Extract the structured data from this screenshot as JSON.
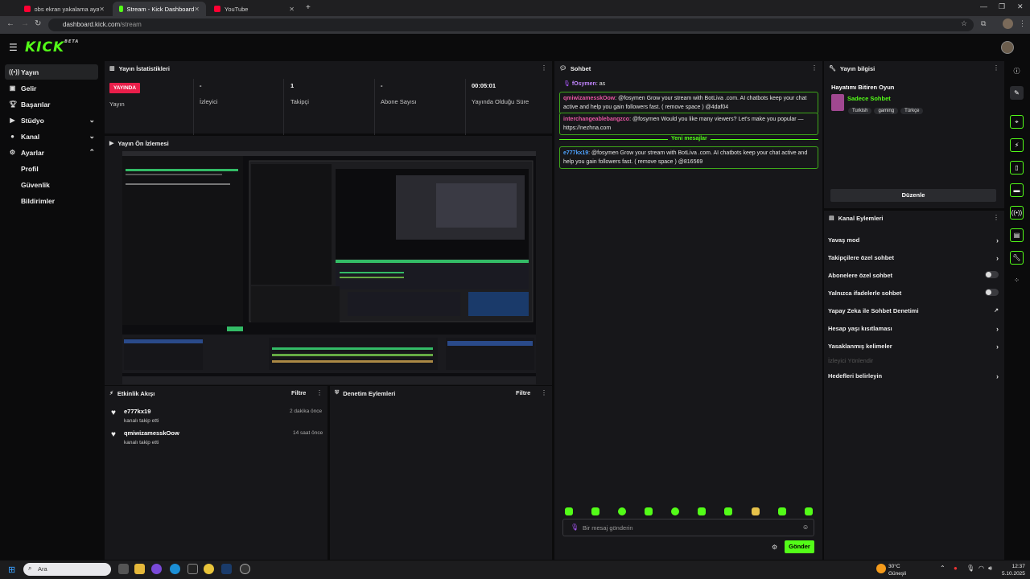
{
  "browser": {
    "tabs": [
      {
        "label": "obs ekran yakalama ayarları - Yo",
        "color": "#ff0033"
      },
      {
        "label": "Stream - Kick Dashboard",
        "color": "#53fc18"
      },
      {
        "label": "YouTube",
        "color": "#ff0033"
      }
    ],
    "url_host": "dashboard.kick.com",
    "url_path": "/stream"
  },
  "logo": "KICK",
  "sidebar": {
    "items": [
      {
        "label": "Yayın",
        "icon": "broadcast-icon"
      },
      {
        "label": "Gelir",
        "icon": "wallet-icon"
      },
      {
        "label": "Başarılar",
        "icon": "trophy-icon"
      },
      {
        "label": "Stüdyo",
        "icon": "video-icon"
      },
      {
        "label": "Kanal",
        "icon": "user-icon"
      },
      {
        "label": "Ayarlar",
        "icon": "gear-icon"
      }
    ],
    "sub_items": [
      "Profil",
      "Güvenlik",
      "Bildirimler"
    ]
  },
  "stats": {
    "title": "Yayın İstatistikleri",
    "live_badge": "YAYINDA",
    "items": [
      {
        "value": "",
        "label": "Yayın"
      },
      {
        "value": "-",
        "label": "İzleyici"
      },
      {
        "value": "1",
        "label": "Takipçi"
      },
      {
        "value": "-",
        "label": "Abone Sayısı"
      },
      {
        "value": "00:05:01",
        "label": "Yayında Olduğu Süre"
      }
    ]
  },
  "preview": {
    "title": "Yayın Ön İzlemesi"
  },
  "activity": {
    "title": "Etkinlik Akışı",
    "filter": "Filtre",
    "items": [
      {
        "user": "e777kx19",
        "action": "kanalı takip etti",
        "time": "2 dakika önce"
      },
      {
        "user": "qmiwizamesskOow",
        "action": "kanalı takip etti",
        "time": "14 saat önce"
      }
    ]
  },
  "moderation": {
    "title": "Denetim Eylemleri",
    "filter": "Filtre"
  },
  "chat": {
    "title": "Sohbet",
    "top_line": {
      "user": "fOsymen",
      "text": ": as"
    },
    "messages": [
      {
        "user": "qmiwizamesskOow",
        "user_color": "#e857a4",
        "text": ": @fosymen Grow your stream with BotLiva .com. AI chatbots keep your chat active and help you gain followers fast. ( remove space ) @4daf04"
      },
      {
        "user": "interchangeablebangzco",
        "user_color": "#e857a4",
        "text": ": @fosymen Would you like many viewers? Let's make you popular — https://nezhna.com"
      },
      {
        "user": "e777kx19",
        "user_color": "#4ea3ff",
        "text": ": @fosymen Grow your stream with BotLiva .com. AI chatbots keep your chat active and help you gain followers fast. ( remove space ) @816569"
      }
    ],
    "new_messages": "Yeni mesajlar",
    "input_placeholder": "Bir mesaj gönderin",
    "send": "Gönder"
  },
  "stream_info": {
    "title": "Yayın bilgisi",
    "stream_title": "Hayatımı Bitiren Oyun",
    "category": "Sadece Sohbet",
    "tags": [
      "Turkish",
      "gaming",
      "Türkçe"
    ],
    "edit": "Düzenle"
  },
  "channel_actions": {
    "title": "Kanal Eylemleri",
    "rows": [
      {
        "label": "Yavaş mod",
        "control": "chevron"
      },
      {
        "label": "Takipçilere özel sohbet",
        "control": "chevron"
      },
      {
        "label": "Abonelere özel sohbet",
        "control": "toggle"
      },
      {
        "label": "Yalnızca ifadelerle sohbet",
        "control": "toggle"
      },
      {
        "label": "Yapay Zeka ile Sohbet Denetimi",
        "control": "external"
      },
      {
        "label": "Hesap yaşı kısıtlaması",
        "control": "chevron"
      },
      {
        "label": "Yasaklanmış kelimeler",
        "control": "chevron"
      },
      {
        "label": "İzleyici Yönlendir",
        "control": "none",
        "disabled": true
      },
      {
        "label": "Hedefleri belirleyin",
        "control": "chevron"
      }
    ]
  },
  "taskbar": {
    "search": "Ara",
    "weather_temp": "30°C",
    "weather_text": "Güneşli",
    "time": "12:37",
    "date": "5.10.2025"
  }
}
